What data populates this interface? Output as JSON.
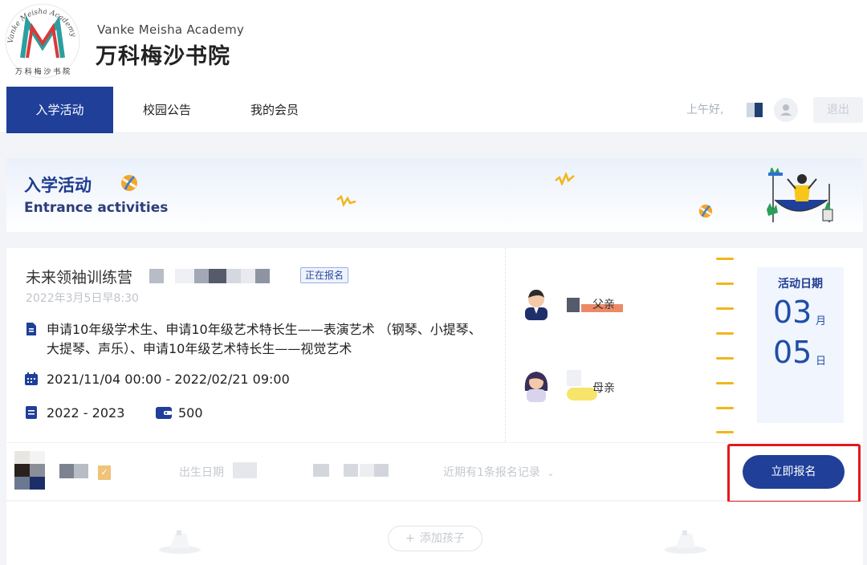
{
  "brand": {
    "seal_text": "Vanke Meisha Academy",
    "seal_text_cn": "万 科 梅 沙 书 院",
    "name_en": "Vanke Meisha Academy",
    "name_cn": "万科梅沙书院"
  },
  "nav": {
    "tabs": [
      {
        "label": "入学活动",
        "active": true
      },
      {
        "label": "校园公告",
        "active": false
      },
      {
        "label": "我的会员",
        "active": false
      }
    ],
    "greeting": "上午好,",
    "logout_label": "退出"
  },
  "banner": {
    "title": "入学活动",
    "subtitle": "Entrance activities"
  },
  "activity": {
    "title": "未来领袖训练营",
    "status": "正在报名",
    "date_text": "2022年3月5日早8:30",
    "target": "申请10年级学术生、申请10年级艺术特长生——表演艺术 （钢琴、小提琴、大提琴、声乐）、申请10年级艺术特长生——视觉艺术",
    "period": "2021/11/04 00:00 - 2022/02/21 09:00",
    "school_year": "2022 - 2023",
    "fee": "500",
    "parents": [
      {
        "relation": "父亲"
      },
      {
        "relation": "母亲"
      }
    ],
    "event_date": {
      "label": "活动日期",
      "month": "03",
      "month_unit": "月",
      "day": "05",
      "day_unit": "日"
    }
  },
  "child": {
    "birth_label": "出生日期",
    "records": "近期有1条报名记录"
  },
  "apply_button": "立即报名",
  "add_child": "添加孩子",
  "colors": {
    "primary": "#1f3f99",
    "accent_yellow": "#f2b61a",
    "highlight_red": "#e5181d"
  }
}
